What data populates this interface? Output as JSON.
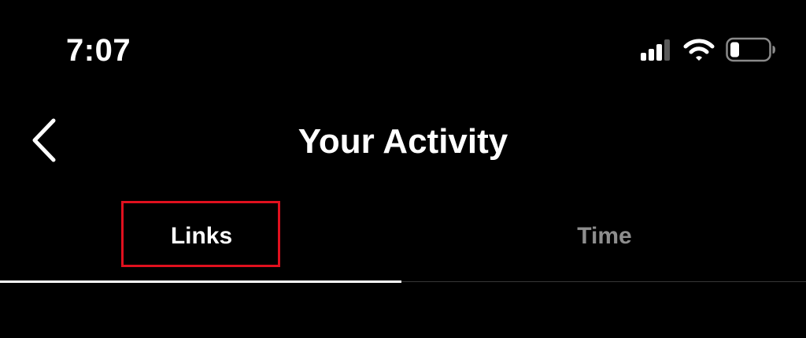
{
  "status_bar": {
    "time": "7:07",
    "icons": [
      "cellular-signal-icon",
      "wifi-icon",
      "battery-icon"
    ],
    "battery_level": 0.2
  },
  "nav": {
    "back_icon": "chevron-left-icon",
    "title": "Your Activity"
  },
  "tabs": [
    {
      "label": "Links",
      "selected": true
    },
    {
      "label": "Time",
      "selected": false
    }
  ],
  "colors": {
    "background": "#000000",
    "text": "#ffffff",
    "inactive_tab": "#8e8e8e",
    "highlight": "#e0101e"
  }
}
